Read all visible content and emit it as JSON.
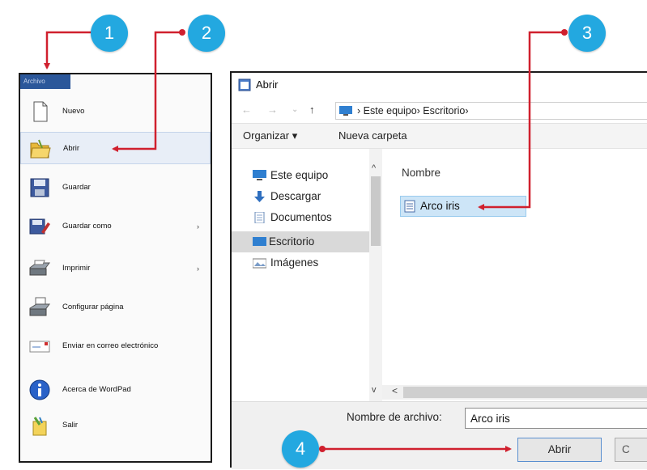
{
  "menu": {
    "tab_label": "Archivo",
    "items": [
      {
        "label": "Nuevo",
        "icon": "blank-document-icon"
      },
      {
        "label": "Abrir",
        "icon": "open-folder-icon"
      },
      {
        "label": "Guardar",
        "icon": "floppy-disk-icon"
      },
      {
        "label": "Guardar como",
        "icon": "save-as-icon",
        "submenu_arrow": "›"
      },
      {
        "label": "Imprimir",
        "icon": "printer-icon",
        "submenu_arrow": "›"
      },
      {
        "label": "Configurar página",
        "icon": "page-setup-icon"
      },
      {
        "label": "Enviar en correo electrónico",
        "icon": "email-icon"
      },
      {
        "label": "Acerca de WordPad",
        "icon": "info-icon"
      },
      {
        "label": "Salir",
        "icon": "exit-icon"
      }
    ]
  },
  "dialog": {
    "title": "Abrir",
    "nav": {
      "back": "←",
      "forward": "→",
      "recent": "⌄",
      "up": "↑"
    },
    "address": "› Este equipo› Escritorio›",
    "toolbar": {
      "organize": "Organizar ▾",
      "new_folder": "Nueva carpeta"
    },
    "navpane": [
      {
        "label": "Este equipo",
        "icon": "computer-icon"
      },
      {
        "label": "Descargar",
        "icon": "download-arrow-icon"
      },
      {
        "label": "Documentos",
        "icon": "documents-icon"
      },
      {
        "label": "Escritorio",
        "icon": "desktop-icon",
        "selected": true
      },
      {
        "label": "Imágenes",
        "icon": "pictures-icon"
      }
    ],
    "column_header": "Nombre",
    "files": [
      {
        "name": "Arco iris",
        "icon": "text-file-icon",
        "selected": true
      }
    ],
    "filename_label": "Nombre de archivo:",
    "filename_value": "Arco iris",
    "open_button": "Abrir",
    "cancel_button": "C",
    "scroll_up": "^",
    "scroll_down": "v",
    "scroll_left": "<"
  },
  "callouts": [
    "1",
    "2",
    "3",
    "4"
  ],
  "colors": {
    "callout": "#23a8e0",
    "arrow": "#d0202e",
    "accent": "#2b579a",
    "selection": "#cde5f7"
  }
}
